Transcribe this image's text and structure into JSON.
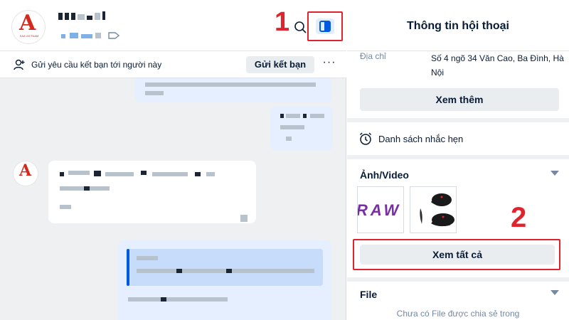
{
  "chat": {
    "header": {
      "contact_name": "",
      "marker": "1",
      "avatar_text": "A",
      "avatar_subtext": "SAA VIETNAM"
    },
    "friend_bar": {
      "text": "Gửi yêu cầu kết bạn tới người này",
      "button_label": "Gửi kết bạn",
      "more_label": "···"
    }
  },
  "info": {
    "title": "Thông tin hội thoại",
    "address": {
      "label": "Địa chỉ",
      "value": "Số 4 ngõ 34 Văn Cao, Ba Đình, Hà Nội"
    },
    "see_more_label": "Xem thêm",
    "reminder_label": "Danh sách nhắc hẹn",
    "media": {
      "title": "Ảnh/Video",
      "thumb_1_text": "RAW",
      "see_all_label": "Xem tất cả",
      "marker": "2"
    },
    "file": {
      "title": "File",
      "empty_text": "Chưa có File được chia sẻ trong"
    }
  },
  "colors": {
    "accent": "#005ae0",
    "highlight": "#e0242d",
    "chat_bg": "#eef0f1",
    "bubble_out": "#e5efff"
  }
}
